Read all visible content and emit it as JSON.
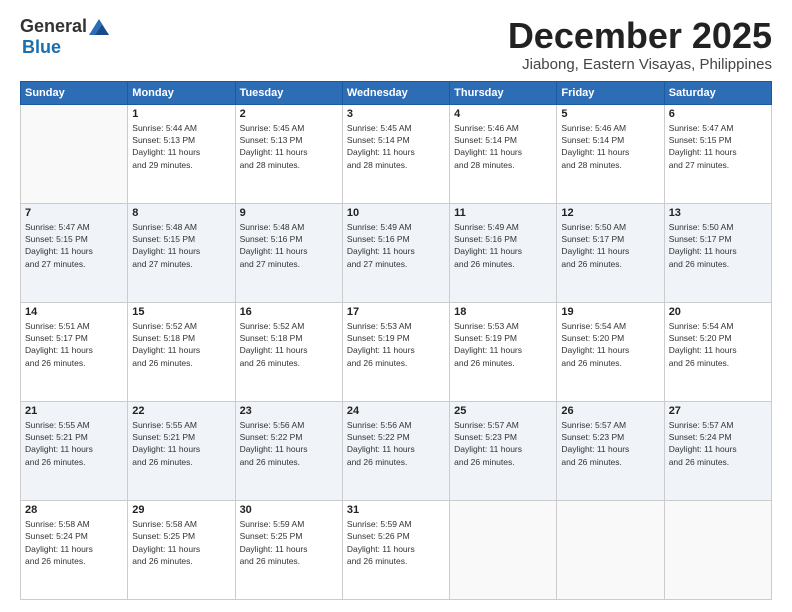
{
  "header": {
    "logo_general": "General",
    "logo_blue": "Blue",
    "month_title": "December 2025",
    "location": "Jiabong, Eastern Visayas, Philippines"
  },
  "weekdays": [
    "Sunday",
    "Monday",
    "Tuesday",
    "Wednesday",
    "Thursday",
    "Friday",
    "Saturday"
  ],
  "weeks": [
    [
      {
        "day": "",
        "info": ""
      },
      {
        "day": "1",
        "info": "Sunrise: 5:44 AM\nSunset: 5:13 PM\nDaylight: 11 hours\nand 29 minutes."
      },
      {
        "day": "2",
        "info": "Sunrise: 5:45 AM\nSunset: 5:13 PM\nDaylight: 11 hours\nand 28 minutes."
      },
      {
        "day": "3",
        "info": "Sunrise: 5:45 AM\nSunset: 5:14 PM\nDaylight: 11 hours\nand 28 minutes."
      },
      {
        "day": "4",
        "info": "Sunrise: 5:46 AM\nSunset: 5:14 PM\nDaylight: 11 hours\nand 28 minutes."
      },
      {
        "day": "5",
        "info": "Sunrise: 5:46 AM\nSunset: 5:14 PM\nDaylight: 11 hours\nand 28 minutes."
      },
      {
        "day": "6",
        "info": "Sunrise: 5:47 AM\nSunset: 5:15 PM\nDaylight: 11 hours\nand 27 minutes."
      }
    ],
    [
      {
        "day": "7",
        "info": "Sunrise: 5:47 AM\nSunset: 5:15 PM\nDaylight: 11 hours\nand 27 minutes."
      },
      {
        "day": "8",
        "info": "Sunrise: 5:48 AM\nSunset: 5:15 PM\nDaylight: 11 hours\nand 27 minutes."
      },
      {
        "day": "9",
        "info": "Sunrise: 5:48 AM\nSunset: 5:16 PM\nDaylight: 11 hours\nand 27 minutes."
      },
      {
        "day": "10",
        "info": "Sunrise: 5:49 AM\nSunset: 5:16 PM\nDaylight: 11 hours\nand 27 minutes."
      },
      {
        "day": "11",
        "info": "Sunrise: 5:49 AM\nSunset: 5:16 PM\nDaylight: 11 hours\nand 26 minutes."
      },
      {
        "day": "12",
        "info": "Sunrise: 5:50 AM\nSunset: 5:17 PM\nDaylight: 11 hours\nand 26 minutes."
      },
      {
        "day": "13",
        "info": "Sunrise: 5:50 AM\nSunset: 5:17 PM\nDaylight: 11 hours\nand 26 minutes."
      }
    ],
    [
      {
        "day": "14",
        "info": "Sunrise: 5:51 AM\nSunset: 5:17 PM\nDaylight: 11 hours\nand 26 minutes."
      },
      {
        "day": "15",
        "info": "Sunrise: 5:52 AM\nSunset: 5:18 PM\nDaylight: 11 hours\nand 26 minutes."
      },
      {
        "day": "16",
        "info": "Sunrise: 5:52 AM\nSunset: 5:18 PM\nDaylight: 11 hours\nand 26 minutes."
      },
      {
        "day": "17",
        "info": "Sunrise: 5:53 AM\nSunset: 5:19 PM\nDaylight: 11 hours\nand 26 minutes."
      },
      {
        "day": "18",
        "info": "Sunrise: 5:53 AM\nSunset: 5:19 PM\nDaylight: 11 hours\nand 26 minutes."
      },
      {
        "day": "19",
        "info": "Sunrise: 5:54 AM\nSunset: 5:20 PM\nDaylight: 11 hours\nand 26 minutes."
      },
      {
        "day": "20",
        "info": "Sunrise: 5:54 AM\nSunset: 5:20 PM\nDaylight: 11 hours\nand 26 minutes."
      }
    ],
    [
      {
        "day": "21",
        "info": "Sunrise: 5:55 AM\nSunset: 5:21 PM\nDaylight: 11 hours\nand 26 minutes."
      },
      {
        "day": "22",
        "info": "Sunrise: 5:55 AM\nSunset: 5:21 PM\nDaylight: 11 hours\nand 26 minutes."
      },
      {
        "day": "23",
        "info": "Sunrise: 5:56 AM\nSunset: 5:22 PM\nDaylight: 11 hours\nand 26 minutes."
      },
      {
        "day": "24",
        "info": "Sunrise: 5:56 AM\nSunset: 5:22 PM\nDaylight: 11 hours\nand 26 minutes."
      },
      {
        "day": "25",
        "info": "Sunrise: 5:57 AM\nSunset: 5:23 PM\nDaylight: 11 hours\nand 26 minutes."
      },
      {
        "day": "26",
        "info": "Sunrise: 5:57 AM\nSunset: 5:23 PM\nDaylight: 11 hours\nand 26 minutes."
      },
      {
        "day": "27",
        "info": "Sunrise: 5:57 AM\nSunset: 5:24 PM\nDaylight: 11 hours\nand 26 minutes."
      }
    ],
    [
      {
        "day": "28",
        "info": "Sunrise: 5:58 AM\nSunset: 5:24 PM\nDaylight: 11 hours\nand 26 minutes."
      },
      {
        "day": "29",
        "info": "Sunrise: 5:58 AM\nSunset: 5:25 PM\nDaylight: 11 hours\nand 26 minutes."
      },
      {
        "day": "30",
        "info": "Sunrise: 5:59 AM\nSunset: 5:25 PM\nDaylight: 11 hours\nand 26 minutes."
      },
      {
        "day": "31",
        "info": "Sunrise: 5:59 AM\nSunset: 5:26 PM\nDaylight: 11 hours\nand 26 minutes."
      },
      {
        "day": "",
        "info": ""
      },
      {
        "day": "",
        "info": ""
      },
      {
        "day": "",
        "info": ""
      }
    ]
  ]
}
